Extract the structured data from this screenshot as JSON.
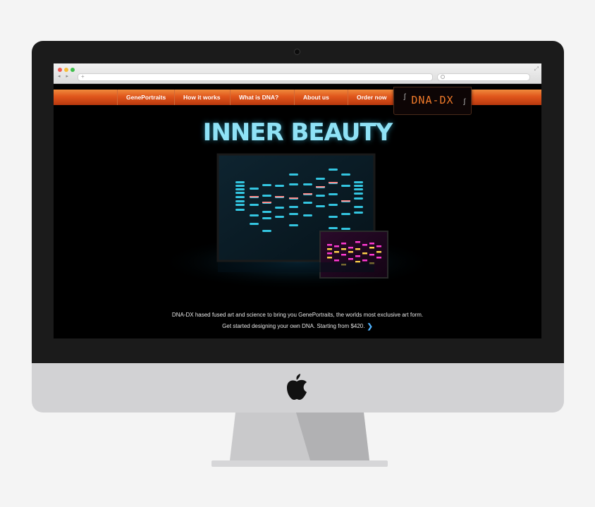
{
  "browser": {
    "nav_buttons": "◂ ▸",
    "new_tab": "+",
    "expand_icon": "⤢"
  },
  "nav": {
    "items": [
      {
        "label": "GenePortraits"
      },
      {
        "label": "How it works"
      },
      {
        "label": "What is DNA?"
      },
      {
        "label": "About us"
      },
      {
        "label": "Order now"
      }
    ]
  },
  "logo": {
    "text": "DNA-DX"
  },
  "hero": {
    "title": "INNER BEAUTY"
  },
  "tagline": "DNA-DX hased fused art and science to bring you GenePortraits, the worlds most exclusive art form.",
  "cta": {
    "text": "Get started designing your own DNA. Starting from $420."
  },
  "colors": {
    "nav_orange": "#e0561c",
    "accent_cyan": "#8fe2f6",
    "accent_magenta": "#ff3ad1",
    "cta_arrow": "#4fb3ff"
  },
  "icons": [
    "apple-icon",
    "search-icon",
    "expand-icon",
    "chevron-right-icon"
  ]
}
